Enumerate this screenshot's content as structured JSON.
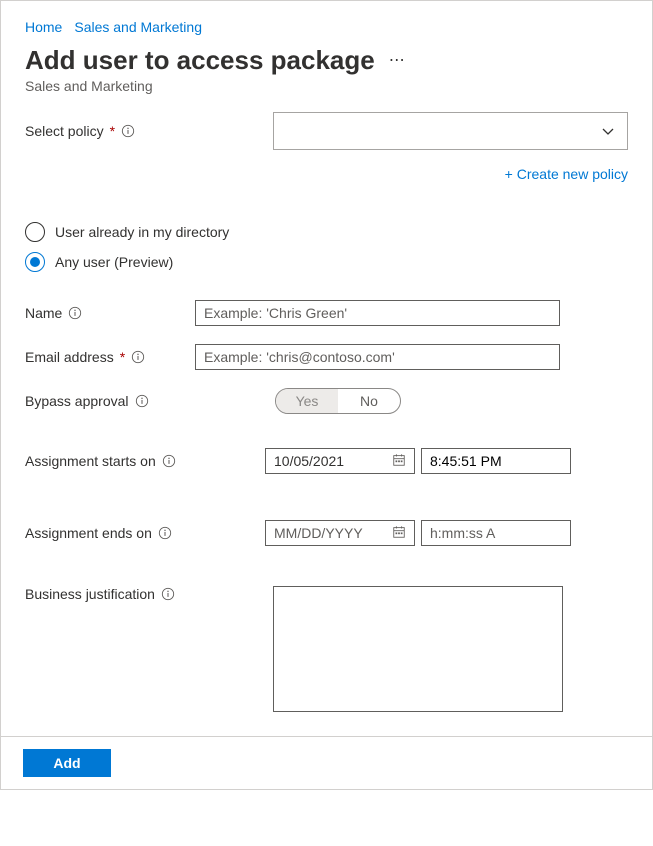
{
  "breadcrumb": {
    "home": "Home",
    "salesMarketing": "Sales and Marketing"
  },
  "page": {
    "title": "Add user to access package",
    "subtitle": "Sales and Marketing"
  },
  "policy": {
    "label": "Select policy",
    "createNewLink": "+ Create new policy"
  },
  "userType": {
    "opt1": "User already in my directory",
    "opt2": "Any user (Preview)"
  },
  "name": {
    "label": "Name",
    "placeholder": "Example: 'Chris Green'"
  },
  "email": {
    "label": "Email address",
    "placeholder": "Example: 'chris@contoso.com'"
  },
  "bypass": {
    "label": "Bypass approval",
    "yes": "Yes",
    "no": "No"
  },
  "start": {
    "label": "Assignment starts on",
    "date": "10/05/2021",
    "time": "8:45:51 PM"
  },
  "end": {
    "label": "Assignment ends on",
    "datePlaceholder": "MM/DD/YYYY",
    "timePlaceholder": "h:mm:ss A"
  },
  "justification": {
    "label": "Business justification"
  },
  "footer": {
    "addBtn": "Add"
  }
}
